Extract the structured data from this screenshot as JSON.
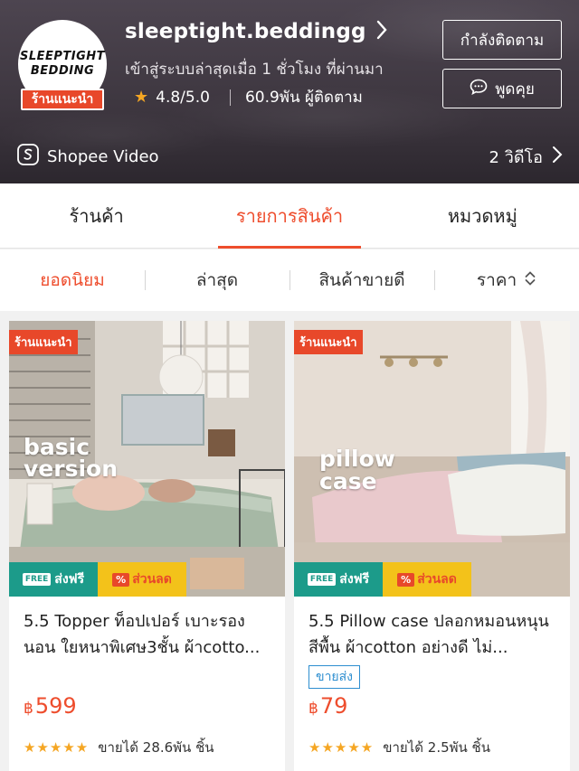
{
  "shop": {
    "logo_line1": "SLEEPTIGHT",
    "logo_line2": "BEDDING",
    "recommended_badge": "ร้านแนะนำ",
    "name": "sleeptight.beddingg",
    "last_active": "เข้าสู่ระบบล่าสุดเมื่อ 1 ชั่วโมง ที่ผ่านมา",
    "rating": "4.8/5.0",
    "followers": "60.9พัน ผู้ติดตาม",
    "follow_label": "กำลังติดตาม",
    "chat_label": "พูดคุย",
    "video_label": "Shopee Video",
    "video_count": "2 วิดีโอ"
  },
  "tabs": [
    {
      "label": "ร้านค้า",
      "active": false
    },
    {
      "label": "รายการสินค้า",
      "active": true
    },
    {
      "label": "หมวดหมู่",
      "active": false
    }
  ],
  "sort": [
    {
      "label": "ยอดนิยม",
      "active": true
    },
    {
      "label": "ล่าสุด",
      "active": false
    },
    {
      "label": "สินค้าขายดี",
      "active": false
    },
    {
      "label": "ราคา",
      "active": false
    }
  ],
  "products": [
    {
      "badge": "ร้านแนะนำ",
      "overlay_line1": "basic",
      "overlay_line2": "version",
      "title": "5.5 Topper ท็อปเปอร์ เบาะรองนอน ใยหนาพิเศษ3ชั้น ผ้าcotto...",
      "price": "599",
      "currency": "฿",
      "sold": "ขายได้ 28.6พัน ชิ้น",
      "stars": "★★★★★",
      "wholesale": "",
      "promo_free": "ส่งฟรี",
      "promo_free_pill": "FREE",
      "promo_discount": "ส่วนลด",
      "promo_discount_pill": "%"
    },
    {
      "badge": "ร้านแนะนำ",
      "overlay_line1": "pillow",
      "overlay_line2": "case",
      "title": "5.5 Pillow case ปลอกหมอนหนุน สีพื้น ผ้าcotton อย่างดี ไม่...",
      "price": "79",
      "currency": "฿",
      "sold": "ขายได้ 2.5พัน ชิ้น",
      "stars": "★★★★★",
      "wholesale": "ขายส่ง",
      "promo_free": "ส่งฟรี",
      "promo_free_pill": "FREE",
      "promo_discount": "ส่วนลด",
      "promo_discount_pill": "%"
    }
  ],
  "colors": {
    "accent": "#ee4d2d",
    "badge": "#e8482a",
    "star": "#f5a623",
    "free_shipping": "#1c9b8a",
    "discount": "#f3c21a",
    "wholesale": "#2d8ed0"
  }
}
